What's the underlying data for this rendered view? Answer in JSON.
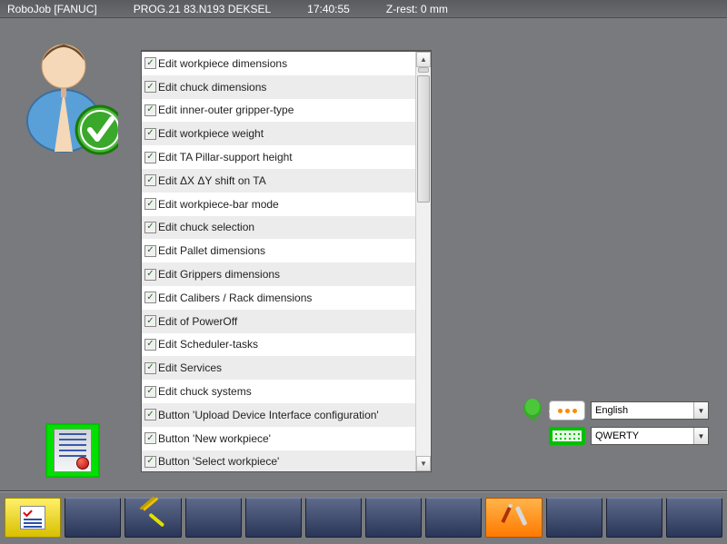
{
  "titlebar": {
    "app": "RoboJob [FANUC]",
    "prog": "PROG.21 83.N193 DEKSEL",
    "time": "17:40:55",
    "zrest": "Z-rest: 0 mm"
  },
  "permissions": [
    "Edit workpiece dimensions",
    "Edit chuck dimensions",
    "Edit inner-outer gripper-type",
    "Edit workpiece weight",
    "Edit TA Pillar-support height",
    "Edit ΔX ΔY shift on TA",
    "Edit workpiece-bar mode",
    "Edit chuck selection",
    "Edit Pallet dimensions",
    "Edit Grippers dimensions",
    "Edit Calibers / Rack dimensions",
    "Edit of PowerOff",
    "Edit Scheduler-tasks",
    "Edit Services",
    "Edit chuck systems",
    "Button 'Upload Device Interface configuration'",
    "Button 'New workpiece'",
    "Button 'Select workpiece'"
  ],
  "dropdowns": {
    "language": "English",
    "keyboard": "QWERTY"
  }
}
